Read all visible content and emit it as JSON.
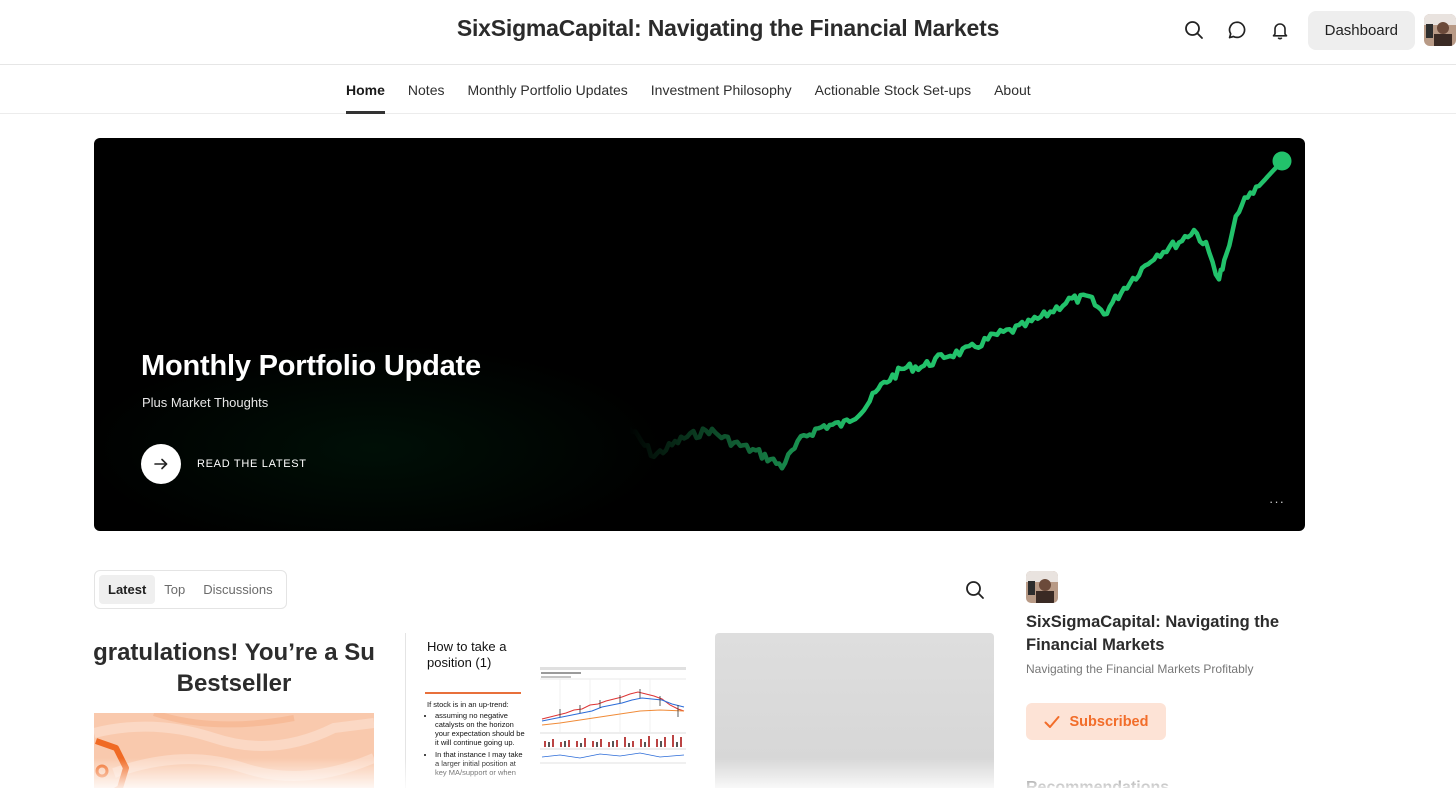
{
  "header": {
    "site_title": "SixSigmaCapital: Navigating the Financial Markets",
    "actions": {
      "search_icon": "search-icon",
      "chat_icon": "chat-bubble-icon",
      "notification_icon": "bell-icon",
      "dashboard_label": "Dashboard"
    }
  },
  "nav": {
    "items": [
      {
        "label": "Home",
        "active": true
      },
      {
        "label": "Notes",
        "active": false
      },
      {
        "label": "Monthly Portfolio Updates",
        "active": false
      },
      {
        "label": "Investment Philosophy",
        "active": false
      },
      {
        "label": "Actionable Stock Set-ups",
        "active": false
      },
      {
        "label": "About",
        "active": false
      }
    ]
  },
  "hero": {
    "title": "Monthly Portfolio Update",
    "subtitle": "Plus Market Thoughts",
    "cta_label": "READ THE LATEST",
    "more_label": "···",
    "line_color": "#22c26b",
    "background": "#000000"
  },
  "feed": {
    "tabs": [
      {
        "label": "Latest",
        "active": true
      },
      {
        "label": "Top",
        "active": false
      },
      {
        "label": "Discussions",
        "active": false
      }
    ],
    "posts": [
      {
        "headline_line1": "gratulations! You’re a Su",
        "headline_line2": "Bestseller"
      },
      {
        "title": "How to take a position (1)",
        "intro": "If stock is in an up-trend:",
        "bullets": [
          "assuming no negative catalysts on the horizon your expectation should be it will continue going up.",
          "In that instance I may take a larger initial position at key MA/support or when"
        ]
      },
      {}
    ]
  },
  "sidebar": {
    "title": "SixSigmaCapital: Navigating the Financial Markets",
    "description": "Navigating the Financial Markets Profitably",
    "subscribe_label": "Subscribed",
    "accent_color": "#f26d2a",
    "recommendations_label": "Recommendations"
  }
}
